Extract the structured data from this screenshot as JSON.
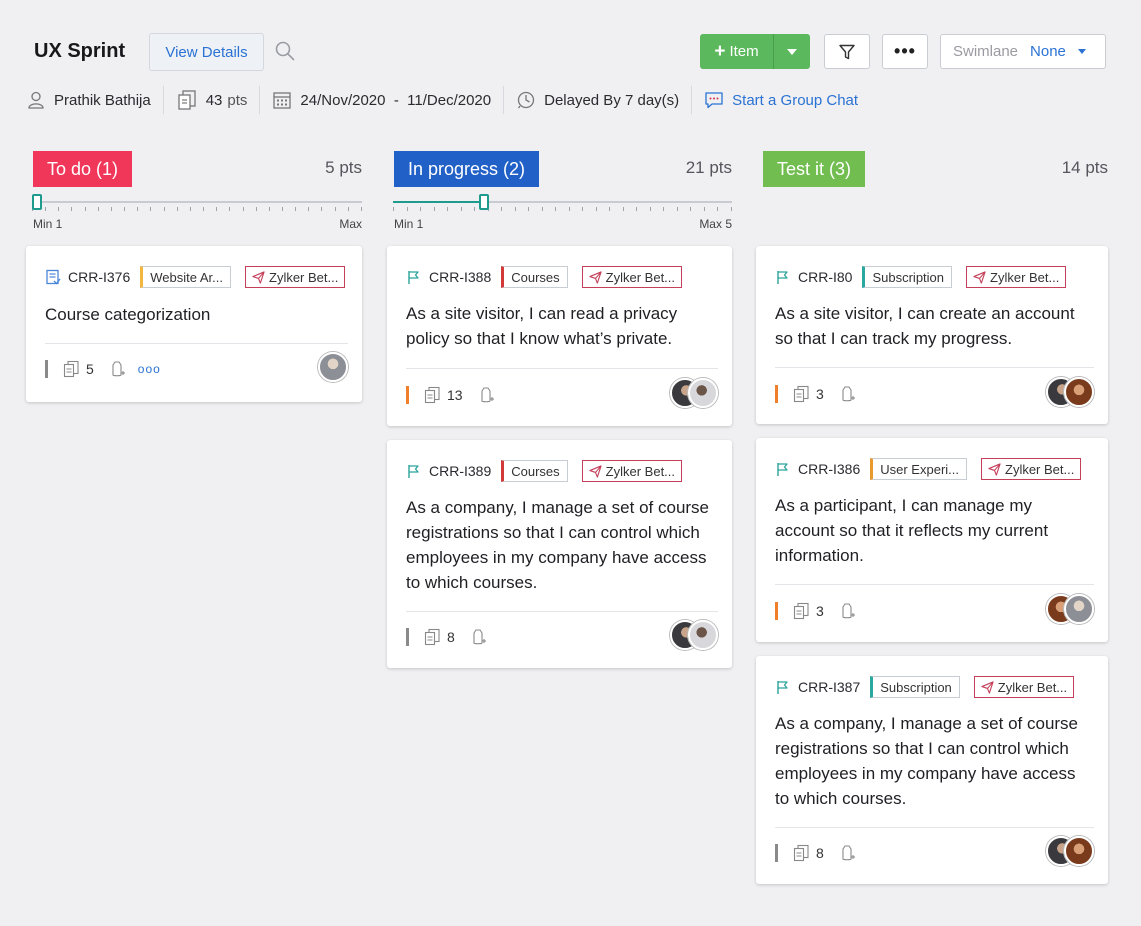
{
  "header": {
    "sprint_title": "UX Sprint",
    "view_details": "View Details",
    "add_item_label": "Item",
    "swimlane_label": "Swimlane",
    "swimlane_value": "None"
  },
  "meta": {
    "owner": "Prathik Bathija",
    "points": "43",
    "points_unit": "pts",
    "date_range": "24/Nov/2020  -  11/Dec/2020",
    "status": "Delayed By 7 day(s)",
    "group_chat": "Start a Group Chat"
  },
  "colors": {
    "todo": "#f0375a",
    "in_progress": "#2161c7",
    "test_it": "#71bd4f",
    "accent_green": "#5cb85c",
    "link_blue": "#2a72d4",
    "wip_teal": "#1e9b8c"
  },
  "columns": [
    {
      "label": "To do (1)",
      "points": "5 pts",
      "wip_min_label": "Min 1",
      "wip_max_label": "Max",
      "cards": [
        {
          "id": "CRR-I376",
          "type_icon": "story-icon",
          "tag": "Website Ar...",
          "release": "Zylker Bet...",
          "title": "Course categorization",
          "points": "5",
          "extra": "ooo"
        }
      ]
    },
    {
      "label": "In progress (2)",
      "points": "21 pts",
      "wip_min_label": "Min 1",
      "wip_max_label": "Max 5",
      "wip_level_fraction": 0.3,
      "cards": [
        {
          "id": "CRR-I388",
          "type_icon": "flag-icon",
          "tag": "Courses",
          "release": "Zylker Bet...",
          "title": "As a site visitor, I can read a privacy policy so that I know what’s private.",
          "points": "13"
        },
        {
          "id": "CRR-I389",
          "type_icon": "flag-icon",
          "tag": "Courses",
          "release": "Zylker Bet...",
          "title": "As a company, I manage a set of course registrations so that I can control which employees in my company have access to which courses.",
          "points": "8"
        }
      ]
    },
    {
      "label": "Test it (3)",
      "points": "14 pts",
      "cards": [
        {
          "id": "CRR-I80",
          "type_icon": "flag-icon",
          "tag": "Subscription",
          "release": "Zylker Bet...",
          "title": "As a site visitor, I can create an account so that I can track my progress.",
          "points": "3"
        },
        {
          "id": "CRR-I386",
          "type_icon": "flag-icon",
          "tag": "User Experi...",
          "release": "Zylker Bet...",
          "title": "As a participant, I can manage my account so that it reflects my current information.",
          "points": "3"
        },
        {
          "id": "CRR-I387",
          "type_icon": "flag-icon",
          "tag": "Subscription",
          "release": "Zylker Bet...",
          "title": "As a company, I manage a set of course registrations so that I can control which employees in my company have access to which courses.",
          "points": "8"
        }
      ]
    }
  ]
}
